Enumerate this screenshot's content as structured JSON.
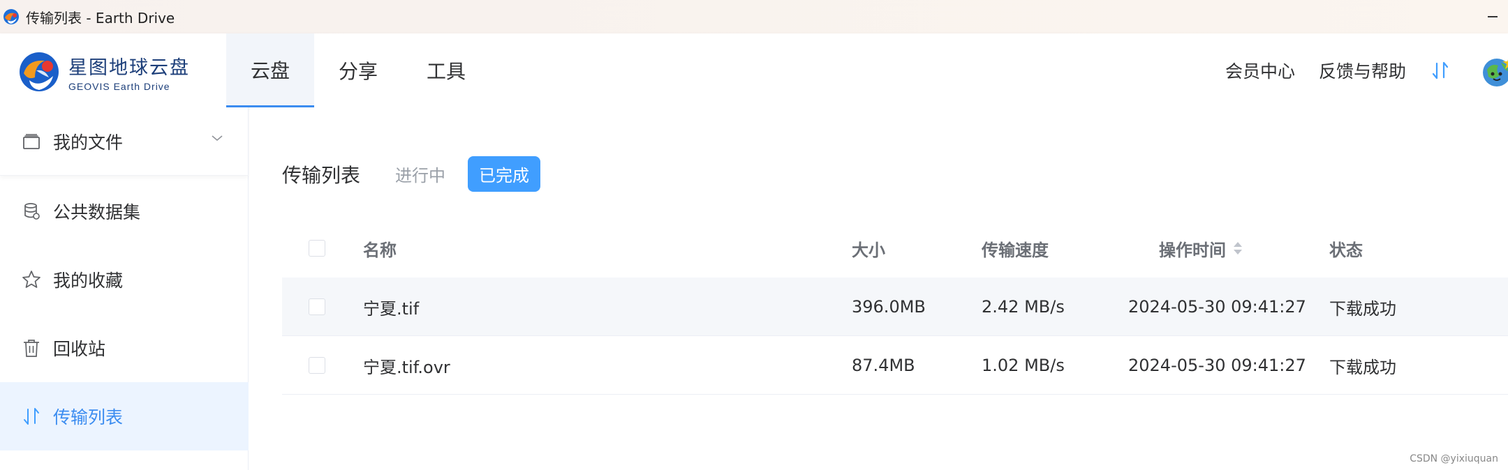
{
  "window": {
    "title": "传输列表 - Earth Drive",
    "app_icon": "earth-drive-icon"
  },
  "header": {
    "logo": {
      "name_cn": "星图地球云盘",
      "name_en": "GEOVIS Earth Drive"
    },
    "nav": [
      {
        "label": "云盘",
        "active": true
      },
      {
        "label": "分享",
        "active": false
      },
      {
        "label": "工具",
        "active": false
      }
    ],
    "links": {
      "vip": "会员中心",
      "help": "反馈与帮助"
    },
    "icons": {
      "transfer": "transfer-arrows-icon",
      "avatar": "earth-avatar"
    }
  },
  "sidebar": {
    "items": [
      {
        "label": "我的文件",
        "icon": "folder-icon",
        "expandable": true
      },
      {
        "label": "公共数据集",
        "icon": "database-icon"
      },
      {
        "label": "我的收藏",
        "icon": "star-icon"
      },
      {
        "label": "回收站",
        "icon": "trash-icon"
      },
      {
        "label": "传输列表",
        "icon": "transfer-arrows-icon",
        "active": true
      }
    ]
  },
  "main": {
    "heading": "传输列表",
    "tabs": [
      {
        "label": "进行中",
        "active": false
      },
      {
        "label": "已完成",
        "active": true
      }
    ],
    "table": {
      "columns": {
        "name": "名称",
        "size": "大小",
        "speed": "传输速度",
        "time": "操作时间",
        "status": "状态"
      },
      "rows": [
        {
          "name": "宁夏.tif",
          "size": "396.0MB",
          "speed": "2.42 MB/s",
          "time": "2024-05-30 09:41:27",
          "status": "下载成功"
        },
        {
          "name": "宁夏.tif.ovr",
          "size": "87.4MB",
          "speed": "1.02 MB/s",
          "time": "2024-05-30 09:41:27",
          "status": "下载成功"
        }
      ]
    }
  },
  "watermark": "CSDN @yixiuquan",
  "colors": {
    "accent": "#409eff",
    "active_bg": "#ecf4ff",
    "header_text": "#303133",
    "muted": "#9aa0a8"
  }
}
